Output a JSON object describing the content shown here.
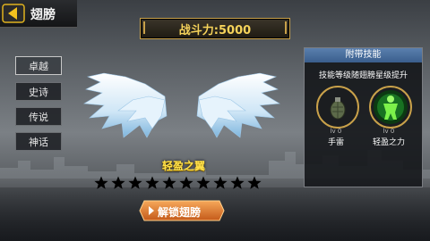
{
  "header": {
    "title": "翅膀",
    "back_icon": "back-arrow-icon"
  },
  "power": {
    "text": "战斗力:5000"
  },
  "tabs": [
    {
      "label": "卓越",
      "active": true
    },
    {
      "label": "史诗",
      "active": false
    },
    {
      "label": "传说",
      "active": false
    },
    {
      "label": "神话",
      "active": false
    }
  ],
  "wing": {
    "name": "轻盈之翼",
    "stars_filled": 10,
    "stars_total": 10
  },
  "unlock_button": {
    "label": "解锁翅膀"
  },
  "skill_panel": {
    "title": "附带技能",
    "description": "技能等级随翅膀星级提升",
    "skills": [
      {
        "icon": "grenade-icon",
        "level": "lv 0",
        "name": "手雷"
      },
      {
        "icon": "green-aura-figure-icon",
        "level": "lv 0",
        "name": "轻盈之力"
      }
    ]
  },
  "colors": {
    "accent_gold": "#f6d35a",
    "panel_header": "#4a6f9e",
    "star": "#000000"
  }
}
